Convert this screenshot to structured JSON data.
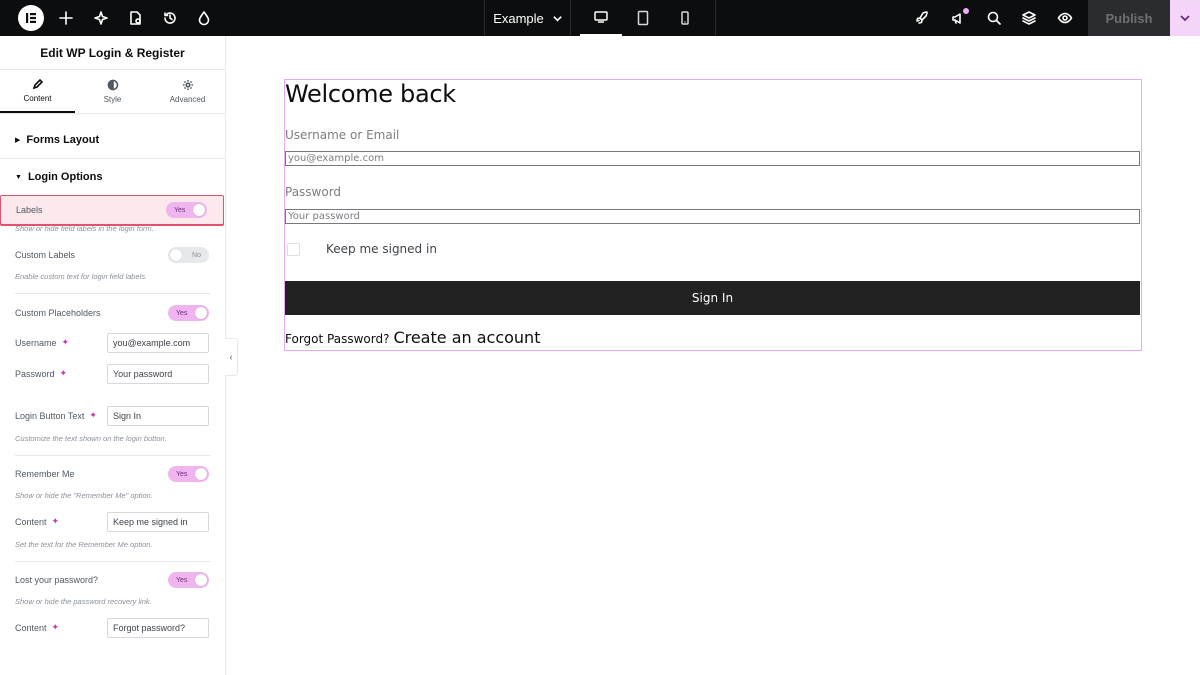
{
  "topbar": {
    "site_name": "Example",
    "publish_label": "Publish"
  },
  "panel": {
    "title": "Edit WP Login & Register",
    "tabs": [
      {
        "label": "Content",
        "icon": "pencil-icon",
        "active": true
      },
      {
        "label": "Style",
        "icon": "contrast-icon",
        "active": false
      },
      {
        "label": "Advanced",
        "icon": "gear-icon",
        "active": false
      }
    ],
    "sections": {
      "forms_layout": "Forms Layout",
      "login_options": "Login Options"
    },
    "controls": {
      "labels": {
        "label": "Labels",
        "state": "Yes",
        "desc": "Show or hide field labels in the login form."
      },
      "custom_labels": {
        "label": "Custom Labels",
        "state": "No",
        "desc": "Enable custom text for login field labels."
      },
      "custom_placeholders": {
        "label": "Custom Placeholders",
        "state": "Yes"
      },
      "username": {
        "label": "Username",
        "value": "you@example.com"
      },
      "password": {
        "label": "Password",
        "value": "Your password"
      },
      "login_button_text": {
        "label": "Login Button Text",
        "value": "Sign In",
        "desc": "Customize the text shown on the login button."
      },
      "remember_me": {
        "label": "Remember Me",
        "state": "Yes",
        "desc": "Show or hide the \"Remember Me\" option."
      },
      "remember_content": {
        "label": "Content",
        "value": "Keep me signed in",
        "desc": "Set the text for the Remember Me option."
      },
      "lost_password": {
        "label": "Lost your password?",
        "state": "Yes",
        "desc": "Show or hide the password recovery link."
      },
      "lost_content": {
        "label": "Content",
        "value": "Forgot password?"
      }
    }
  },
  "preview": {
    "heading": "Welcome back",
    "username_label": "Username or Email",
    "username_placeholder": "you@example.com",
    "password_label": "Password",
    "password_placeholder": "Your password",
    "remember_text": "Keep me signed in",
    "button_text": "Sign In",
    "forgot_link": "Forgot Password?",
    "create_link": "Create an account"
  },
  "colors": {
    "topbar_bg": "#0c0d0e",
    "accent_pink": "#f0b5ef",
    "highlight_border": "#e0526d",
    "button_bg": "#222222"
  }
}
